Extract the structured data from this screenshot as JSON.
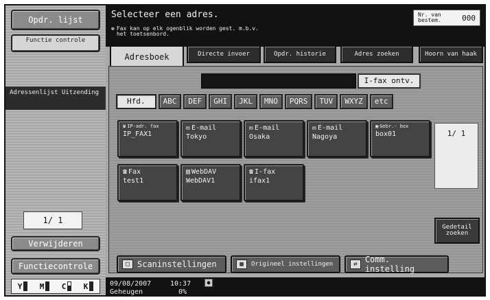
{
  "header": {
    "title": "Selecteer een adres.",
    "message_line1": "Fax kan op elk ogenblik worden gest. m.b.v.",
    "message_line2": "het toetsenbord.",
    "nr_label": "Nr. van bestem.",
    "nr_value": "000"
  },
  "left_panel": {
    "job_list_label": "Opdr. lijst",
    "function_check_label": "Functie controle",
    "section_label": "Adressenlijst Uitzending",
    "page_indicator": "1/ 1",
    "delete_label": "Verwijderen",
    "function_control_label": "Functiecontrole",
    "toner": [
      {
        "letter": "Y",
        "level": 1.0
      },
      {
        "letter": "M",
        "level": 1.0
      },
      {
        "letter": "C",
        "level": 0.6
      },
      {
        "letter": "K",
        "level": 1.0
      }
    ]
  },
  "tabs": [
    {
      "label": "Adresboek"
    },
    {
      "label": "Directe invoer"
    },
    {
      "label": "Opdr. historie"
    },
    {
      "label": "Adres zoeken"
    },
    {
      "label": "Hoorn van haak"
    }
  ],
  "search": {
    "ifax_button": "I-fax ontv."
  },
  "index_tabs": [
    "Hfd.",
    "ABC",
    "DEF",
    "GHI",
    "JKL",
    "MNO",
    "PQRS",
    "TUV",
    "WXYZ",
    "etc"
  ],
  "addresses": [
    {
      "type": "IP-adr. fax",
      "name": "IP_FAX1",
      "icon": "phone-icon"
    },
    {
      "type": "E-mail",
      "name": "Tokyo",
      "icon": "envelope-icon"
    },
    {
      "type": "E-mail",
      "name": "Osaka",
      "icon": "envelope-icon"
    },
    {
      "type": "E-mail",
      "name": "Nagoya",
      "icon": "envelope-icon"
    },
    {
      "type": "Gebr.- box",
      "name": "box01",
      "icon": "box-icon"
    },
    {
      "type": "Fax",
      "name": "test1",
      "icon": "phone-icon"
    },
    {
      "type": "WebDAV",
      "name": "WebDAV1",
      "icon": "document-icon"
    },
    {
      "type": "I-fax",
      "name": "ifax1",
      "icon": "ifax-icon"
    }
  ],
  "address_page": "1/ 1",
  "detail_search_label": "Gedetail zoeken",
  "bottom_buttons": [
    {
      "label": "Scaninstellingen",
      "icon": "scan-icon"
    },
    {
      "label": "Origineel instellingen",
      "icon": "original-icon"
    },
    {
      "label": "Comm. instelling",
      "icon": "comm-icon"
    }
  ],
  "status": {
    "date": "09/08/2007",
    "time": "10:37",
    "memory_label": "Geheugen",
    "memory_value": "0%"
  }
}
